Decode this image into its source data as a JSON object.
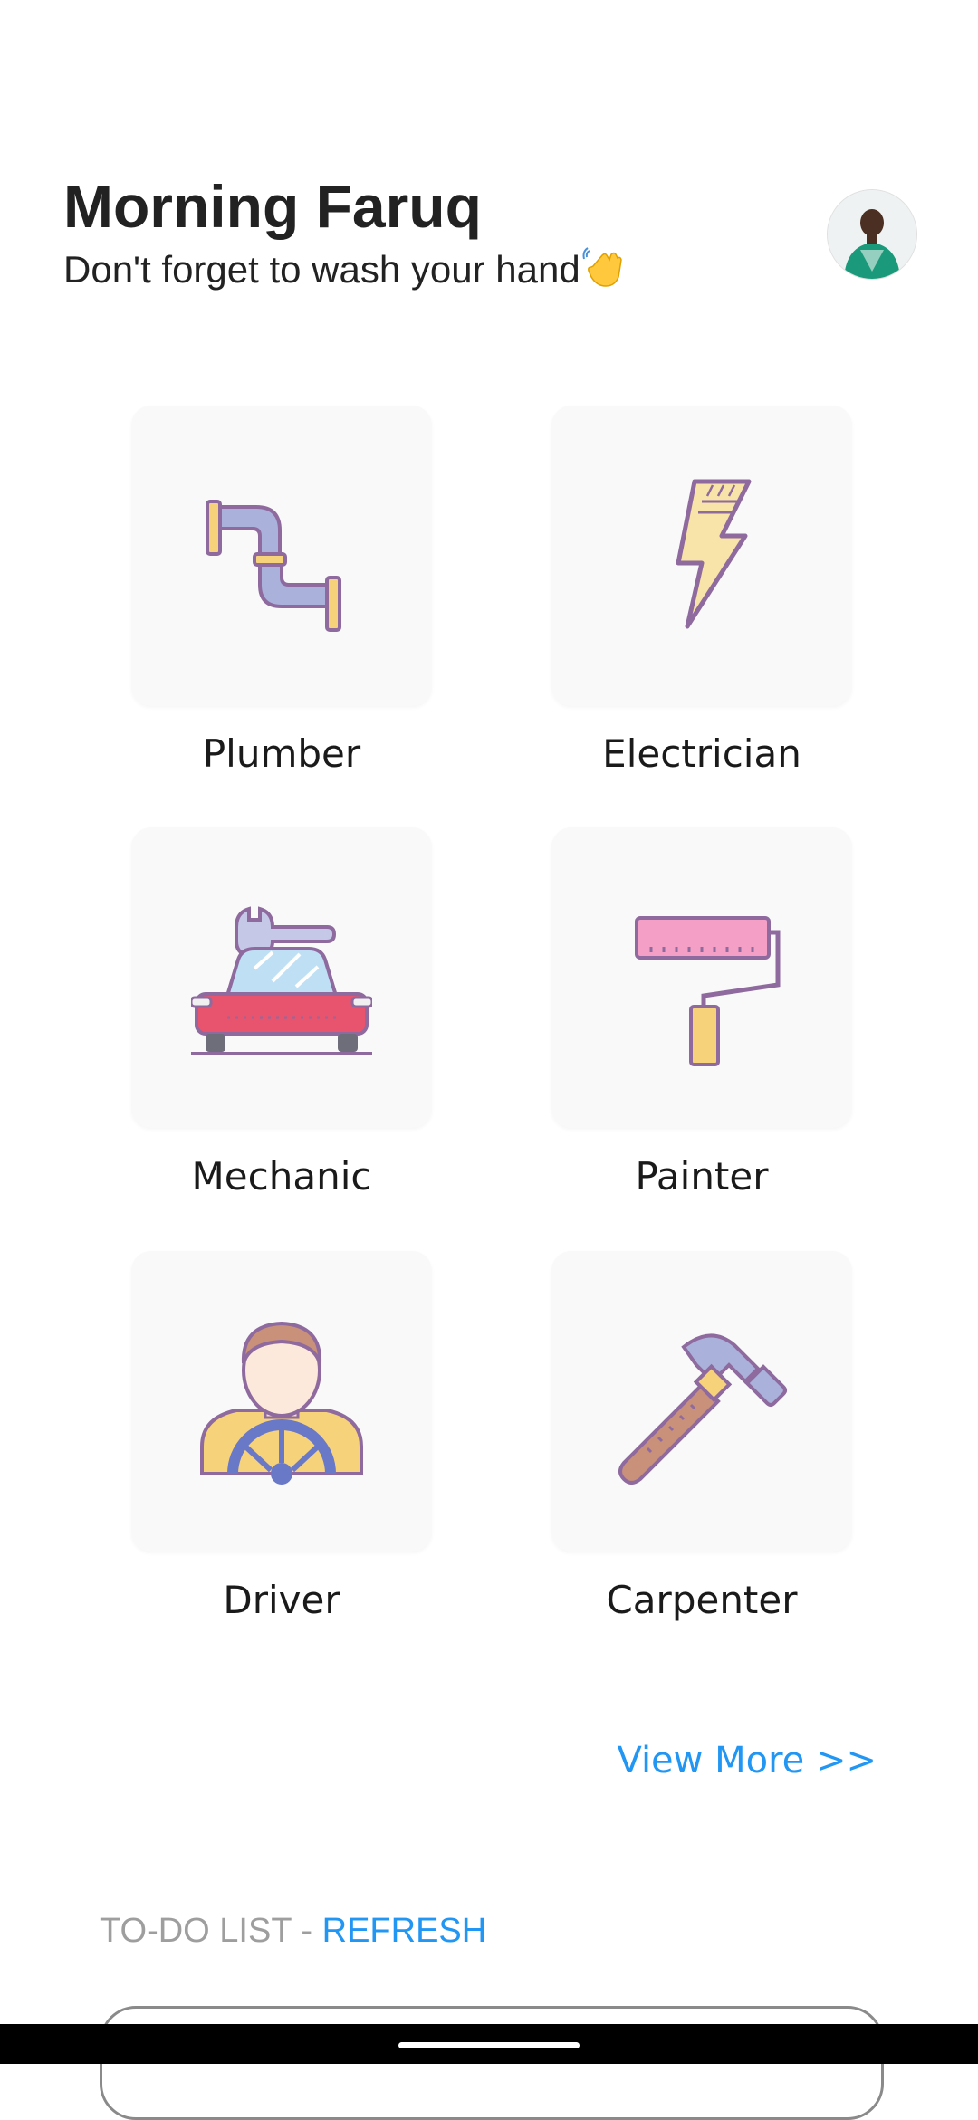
{
  "header": {
    "title": "Morning Faruq",
    "subtitle": "Don't forget to wash your hand",
    "wave_icon": "waving-hand-icon",
    "avatar_icon": "user-avatar"
  },
  "services": [
    {
      "label": "Plumber",
      "icon": "pipe-icon"
    },
    {
      "label": "Electrician",
      "icon": "lightning-icon"
    },
    {
      "label": "Mechanic",
      "icon": "car-wrench-icon"
    },
    {
      "label": "Painter",
      "icon": "paint-roller-icon"
    },
    {
      "label": "Driver",
      "icon": "driver-icon"
    },
    {
      "label": "Carpenter",
      "icon": "hammer-icon"
    }
  ],
  "view_more": "View More >>",
  "todo": {
    "label": "TO-DO LIST - ",
    "refresh": "REFRESH"
  },
  "colors": {
    "accent": "#2196f3",
    "outline": "#8e6a9e",
    "card_bg": "#f9f9f9"
  }
}
